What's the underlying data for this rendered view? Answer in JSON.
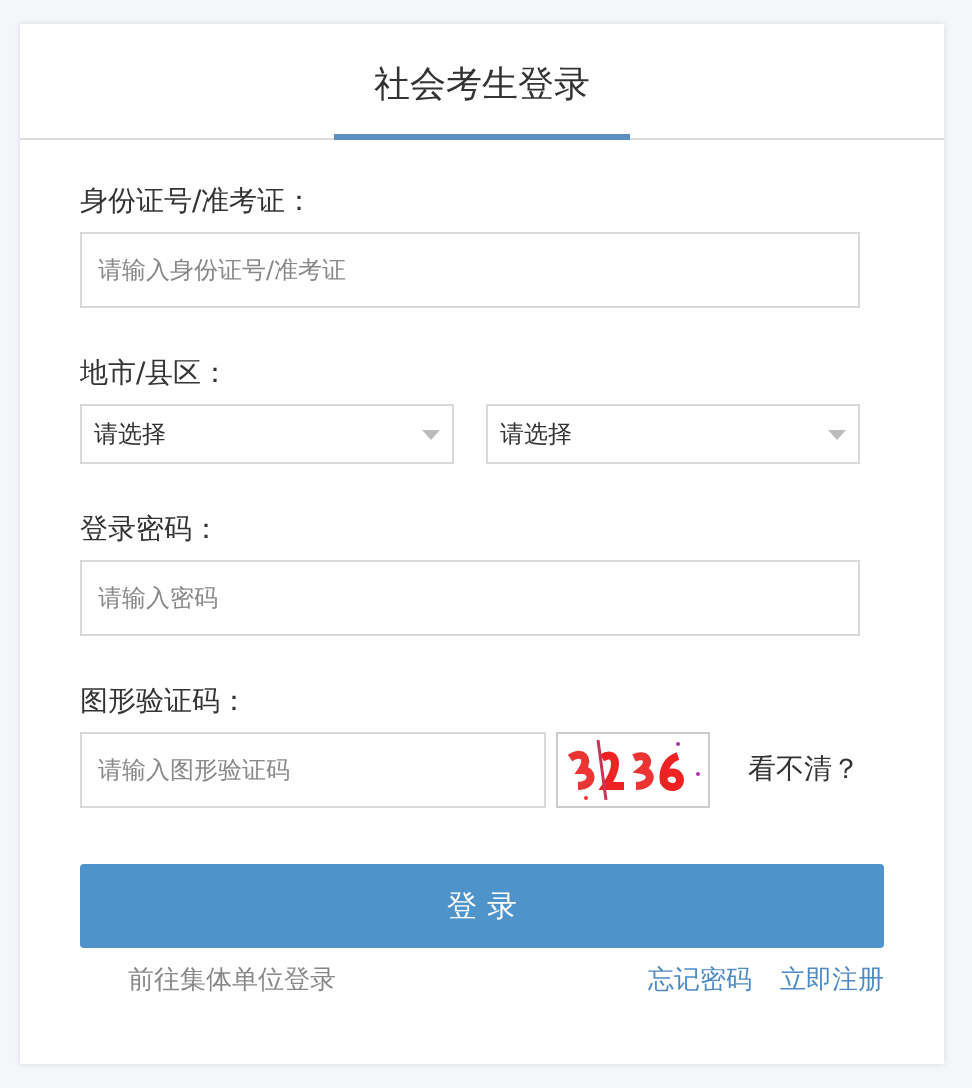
{
  "tabs": [
    {
      "label": "社会考生登录",
      "selected": true
    }
  ],
  "fields": [
    {
      "kind": "text",
      "label": "身份证号/准考证：",
      "placeholder": "请输入身份证号/准考证"
    },
    {
      "kind": "selects",
      "label": "地市/县区：",
      "selects": [
        {
          "value": "请选择"
        },
        {
          "value": "请选择"
        }
      ]
    },
    {
      "kind": "password",
      "label": "登录密码：",
      "placeholder": "请输入密码"
    },
    {
      "kind": "captcha",
      "label": "图形验证码：",
      "placeholder": "请输入图形验证码",
      "refresh": "看不清？"
    }
  ],
  "submit": "登 录",
  "links": {
    "group_login": "前往集体单位登录",
    "forgot": "忘记密码",
    "register": "立即注册"
  }
}
